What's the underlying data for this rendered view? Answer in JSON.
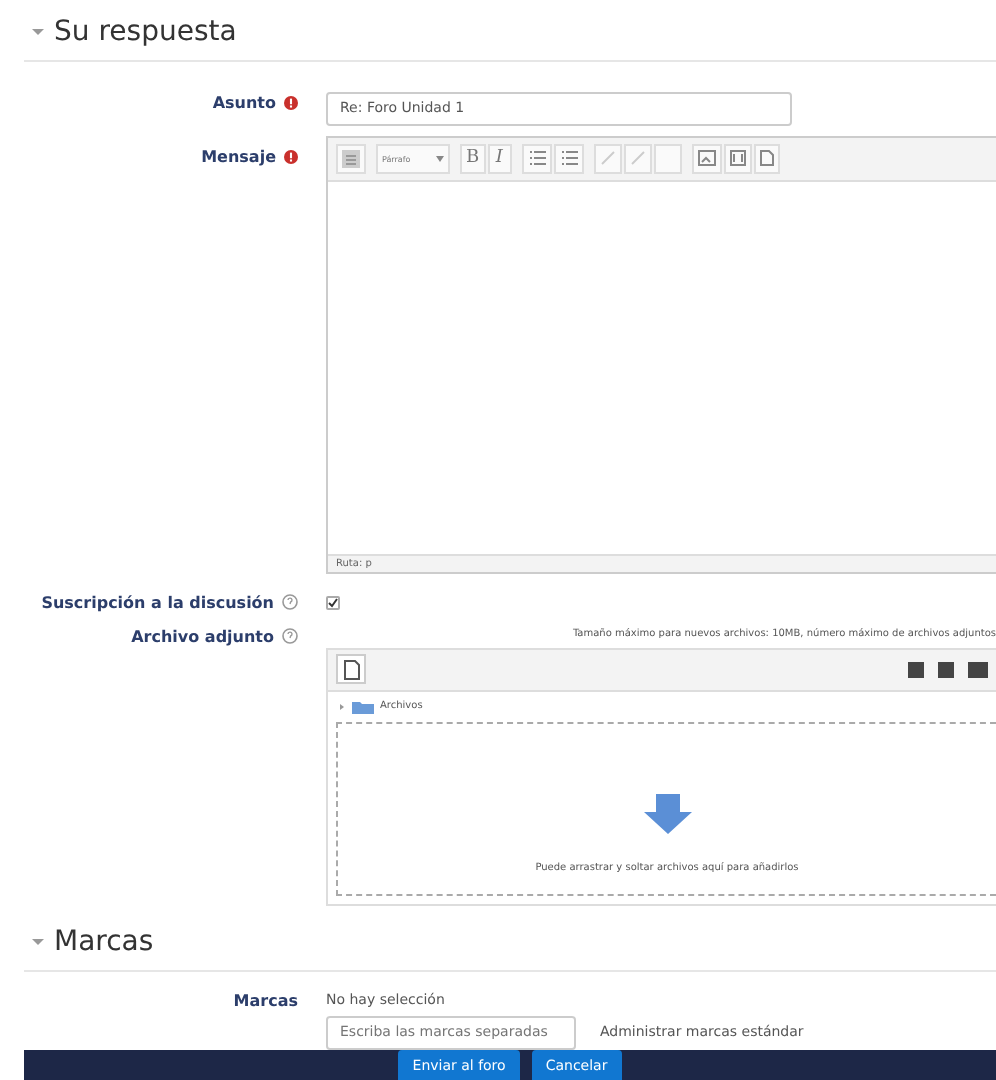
{
  "sections": [
    {
      "title": "Su respuesta",
      "expanded": true
    },
    {
      "title": "Marcas",
      "expanded": true
    }
  ],
  "subject": {
    "label": "Asunto",
    "required": true,
    "value": "Re: Foro Unidad 1"
  },
  "message": {
    "label": "Mensaje",
    "required": true,
    "format": "Párrafo",
    "toolbar": [
      {
        "kind": "toggle",
        "disabled": false
      },
      {
        "kind": "format",
        "disabled": false
      },
      {
        "kind": "bold",
        "label": "B",
        "disabled": false
      },
      {
        "kind": "italic",
        "label": "I",
        "disabled": false
      },
      {
        "kind": "bullets",
        "disabled": false
      },
      {
        "kind": "numbers",
        "disabled": false
      },
      {
        "kind": "link",
        "disabled": true
      },
      {
        "kind": "unlink",
        "disabled": true
      },
      {
        "kind": "blank",
        "disabled": true
      },
      {
        "kind": "image",
        "disabled": false
      },
      {
        "kind": "media",
        "disabled": false
      },
      {
        "kind": "file",
        "disabled": false
      }
    ],
    "path": "Ruta: p"
  },
  "subscription": {
    "label": "Suscripción a la discusión",
    "checked": true
  },
  "attachment": {
    "label": "Archivo adjunto",
    "limits": "Tamaño máximo para nuevos archivos: 10MB, número máximo de archivos adjuntos",
    "folder": "Archivos",
    "drop_hint": "Puede arrastrar y soltar archivos aquí para añadirlos"
  },
  "tags": {
    "label": "Marcas",
    "selection": "No hay selección",
    "placeholder": "Escriba las marcas separadas",
    "manage_link": "Administrar marcas estándar"
  },
  "buttons": [
    {
      "label": "Enviar al foro"
    },
    {
      "label": "Cancelar"
    }
  ]
}
